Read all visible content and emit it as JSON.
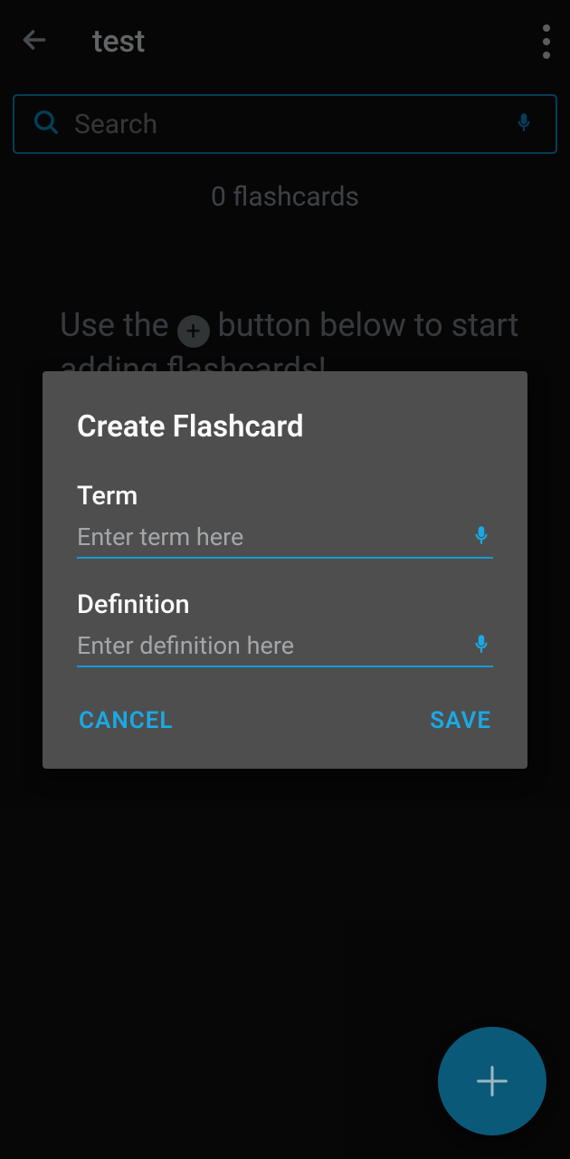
{
  "header": {
    "title": "test"
  },
  "search": {
    "placeholder": "Search",
    "value": ""
  },
  "main": {
    "count_label": "0 flashcards",
    "hint_before": "Use the ",
    "hint_after": " button below to start adding flashcards!"
  },
  "dialog": {
    "title": "Create Flashcard",
    "fields": [
      {
        "label": "Term",
        "placeholder": "Enter term here",
        "value": ""
      },
      {
        "label": "Definition",
        "placeholder": "Enter definition here",
        "value": ""
      }
    ],
    "actions": {
      "cancel": "CANCEL",
      "save": "SAVE"
    }
  },
  "colors": {
    "accent": "#1aa9e5",
    "dialog_bg": "#4e4e4e"
  },
  "icons": {
    "back": "back-arrow-icon",
    "more": "more-vert-icon",
    "search": "search-icon",
    "mic": "microphone-icon",
    "plus_dot": "plus-circle-icon",
    "fab": "plus-icon"
  }
}
